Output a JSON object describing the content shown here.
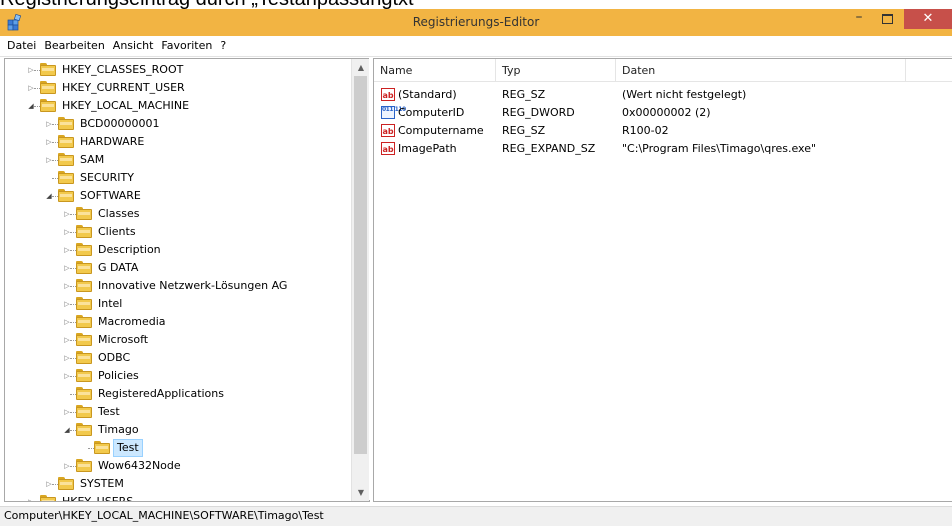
{
  "caption": "Registrierungseintrag durch „Testanpassungtxt“",
  "window": {
    "title": "Registrierungs-Editor",
    "minimize": "–",
    "close": "✕",
    "app_icon": "registry-editor-icon"
  },
  "menu": [
    "Datei",
    "Bearbeiten",
    "Ansicht",
    "Favoriten",
    "?"
  ],
  "tree": [
    {
      "label": "HKEY_CLASSES_ROOT",
      "level": 0,
      "expander": "collapsed"
    },
    {
      "label": "HKEY_CURRENT_USER",
      "level": 0,
      "expander": "collapsed"
    },
    {
      "label": "HKEY_LOCAL_MACHINE",
      "level": 0,
      "expander": "expanded"
    },
    {
      "label": "BCD00000001",
      "level": 1,
      "expander": "collapsed"
    },
    {
      "label": "HARDWARE",
      "level": 1,
      "expander": "collapsed"
    },
    {
      "label": "SAM",
      "level": 1,
      "expander": "collapsed"
    },
    {
      "label": "SECURITY",
      "level": 1,
      "expander": "none"
    },
    {
      "label": "SOFTWARE",
      "level": 1,
      "expander": "expanded"
    },
    {
      "label": "Classes",
      "level": 2,
      "expander": "collapsed"
    },
    {
      "label": "Clients",
      "level": 2,
      "expander": "collapsed"
    },
    {
      "label": "Description",
      "level": 2,
      "expander": "collapsed"
    },
    {
      "label": "G DATA",
      "level": 2,
      "expander": "collapsed"
    },
    {
      "label": "Innovative Netzwerk-Lösungen AG",
      "level": 2,
      "expander": "collapsed"
    },
    {
      "label": "Intel",
      "level": 2,
      "expander": "collapsed"
    },
    {
      "label": "Macromedia",
      "level": 2,
      "expander": "collapsed"
    },
    {
      "label": "Microsoft",
      "level": 2,
      "expander": "collapsed"
    },
    {
      "label": "ODBC",
      "level": 2,
      "expander": "collapsed"
    },
    {
      "label": "Policies",
      "level": 2,
      "expander": "collapsed"
    },
    {
      "label": "RegisteredApplications",
      "level": 2,
      "expander": "none"
    },
    {
      "label": "Test",
      "level": 2,
      "expander": "collapsed"
    },
    {
      "label": "Timago",
      "level": 2,
      "expander": "expanded"
    },
    {
      "label": "Test",
      "level": 3,
      "expander": "none",
      "selected": true
    },
    {
      "label": "Wow6432Node",
      "level": 2,
      "expander": "collapsed"
    },
    {
      "label": "SYSTEM",
      "level": 1,
      "expander": "collapsed"
    },
    {
      "label": "HKEY_USERS",
      "level": 0,
      "expander": "collapsed"
    }
  ],
  "list": {
    "columns": [
      "Name",
      "Typ",
      "Daten"
    ],
    "rows": [
      {
        "icon": "string-value-icon",
        "kind": "sz",
        "glyph": "ab",
        "name": "(Standard)",
        "type": "REG_SZ",
        "data": "(Wert nicht festgelegt)"
      },
      {
        "icon": "binary-value-icon",
        "kind": "dw",
        "glyph": "011 110",
        "name": "ComputerID",
        "type": "REG_DWORD",
        "data": "0x00000002 (2)"
      },
      {
        "icon": "string-value-icon",
        "kind": "sz",
        "glyph": "ab",
        "name": "Computername",
        "type": "REG_SZ",
        "data": "R100-02"
      },
      {
        "icon": "string-value-icon",
        "kind": "sz",
        "glyph": "ab",
        "name": "ImagePath",
        "type": "REG_EXPAND_SZ",
        "data": "\"C:\\Program Files\\Timago\\qres.exe\""
      }
    ]
  },
  "status": {
    "path": "Computer\\HKEY_LOCAL_MACHINE\\SOFTWARE\\Timago\\Test"
  },
  "colors": {
    "titlebar": "#f2b443",
    "close_button": "#c7504a",
    "selection": "#cce8ff",
    "folder": "#f2c94c",
    "string_icon": "#cc2222",
    "dword_icon": "#2a63c9"
  }
}
